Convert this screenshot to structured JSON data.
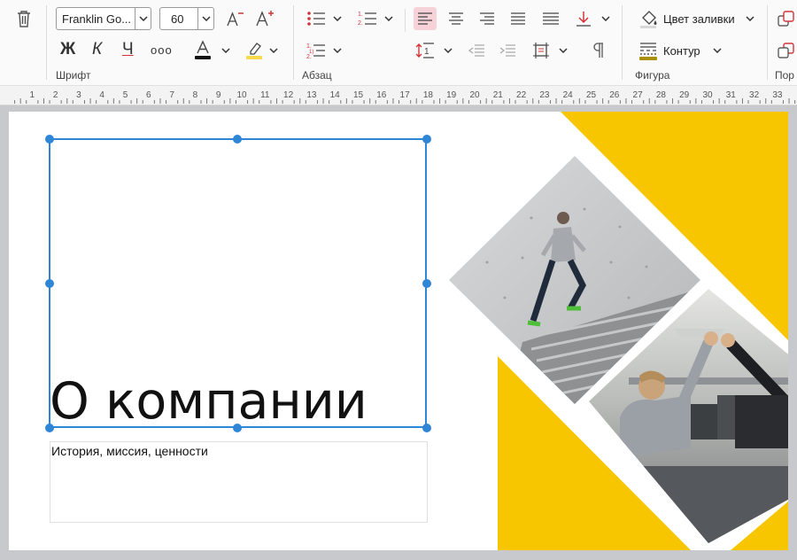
{
  "ribbon": {
    "font_group": {
      "label": "Шрифт",
      "font_name": "Franklin Go...",
      "font_size": "60",
      "bold_label": "Ж",
      "italic_label": "К",
      "underline_label": "Ч",
      "more_label": "ooo"
    },
    "paragraph_group": {
      "label": "Абзац"
    },
    "shape_group": {
      "label": "Фигура",
      "fill_label": "Цвет заливки",
      "outline_label": "Контур"
    },
    "arrange_group": {
      "label": "Пор"
    }
  },
  "ruler": {
    "numbers": [
      "1",
      "2",
      "3",
      "4",
      "5",
      "6",
      "7",
      "8",
      "9",
      "10",
      "11",
      "12",
      "13",
      "14",
      "15",
      "16",
      "17",
      "18",
      "19",
      "20",
      "21",
      "22",
      "23",
      "24",
      "25",
      "26",
      "27",
      "28",
      "29",
      "30",
      "31",
      "32",
      "33"
    ]
  },
  "slide": {
    "title": "О компании",
    "subtitle": "История, миссия, ценности",
    "accent_color": "#F7C600",
    "selection_color": "#2F86D6"
  }
}
